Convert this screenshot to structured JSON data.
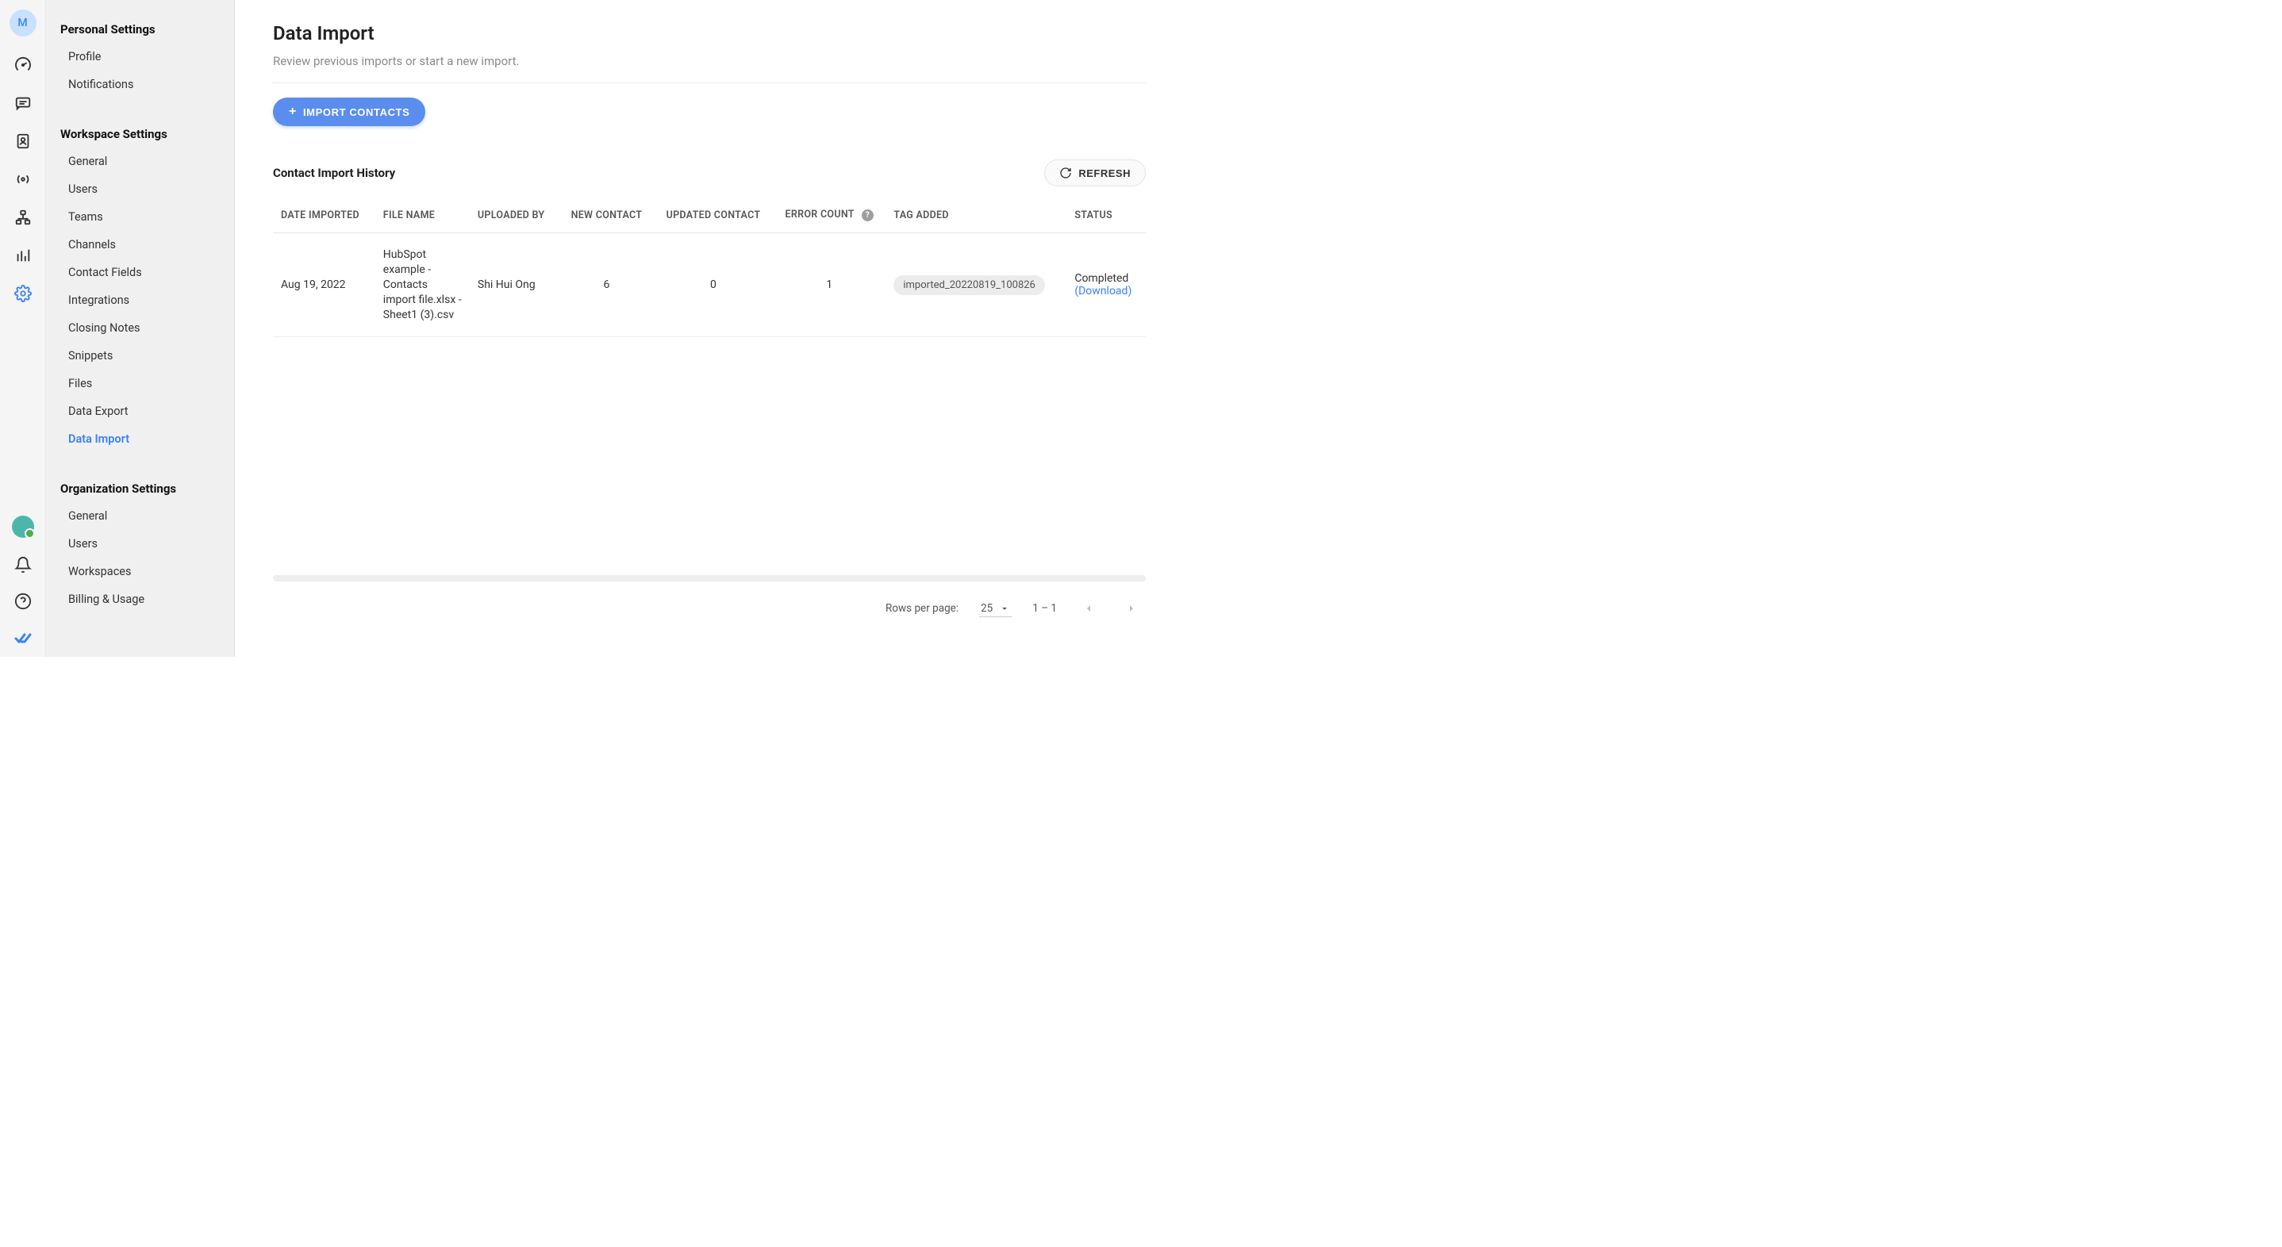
{
  "iconRail": {
    "avatarLetter": "M"
  },
  "sidebar": {
    "personal": {
      "header": "Personal Settings",
      "items": [
        "Profile",
        "Notifications"
      ]
    },
    "workspace": {
      "header": "Workspace Settings",
      "items": [
        "General",
        "Users",
        "Teams",
        "Channels",
        "Contact Fields",
        "Integrations",
        "Closing Notes",
        "Snippets",
        "Files",
        "Data Export",
        "Data Import"
      ]
    },
    "organization": {
      "header": "Organization Settings",
      "items": [
        "General",
        "Users",
        "Workspaces",
        "Billing & Usage"
      ]
    }
  },
  "page": {
    "title": "Data Import",
    "subtitle": "Review previous imports or start a new import.",
    "importBtn": "IMPORT CONTACTS",
    "historyTitle": "Contact Import History",
    "refreshBtn": "REFRESH",
    "columns": {
      "date": "DATE IMPORTED",
      "file": "FILE NAME",
      "uploadedBy": "UPLOADED BY",
      "newContact": "NEW CONTACT",
      "updatedContact": "UPDATED CONTACT",
      "errorCount": "ERROR COUNT",
      "tagAdded": "TAG ADDED",
      "status": "STATUS"
    },
    "rows": [
      {
        "date": "Aug 19, 2022",
        "file": "HubSpot example - Contacts import file.xlsx - Sheet1 (3).csv",
        "uploadedBy": "Shi Hui Ong",
        "newContact": "6",
        "updatedContact": "0",
        "errorCount": "1",
        "tag": "imported_20220819_100826",
        "status": "Completed",
        "download": "(Download)"
      }
    ],
    "pagination": {
      "rowsLabel": "Rows per page:",
      "rowsValue": "25",
      "range": "1 – 1"
    }
  }
}
